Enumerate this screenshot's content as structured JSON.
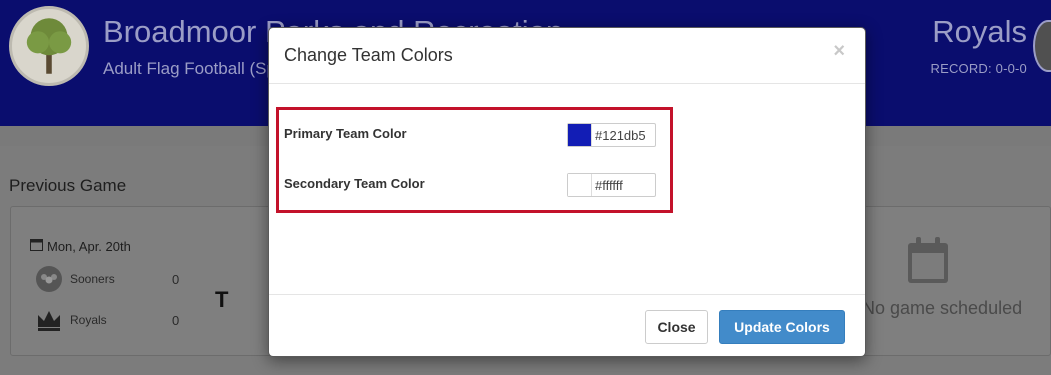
{
  "header": {
    "org_name": "Broadmoor Parks and Recreation",
    "league": "Adult Flag Football (Spring)",
    "team_name": "Royals",
    "record": "RECORD: 0-0-0"
  },
  "previous_game": {
    "section_title": "Previous Game",
    "date": "Mon, Apr. 20th",
    "home_team": "Sooners",
    "home_score": "0",
    "away_team": "Royals",
    "away_score": "0",
    "result": "T"
  },
  "next_game": {
    "status": "No game scheduled"
  },
  "modal": {
    "title": "Change Team Colors",
    "close_symbol": "×",
    "primary_label": "Primary Team Color",
    "primary_value": "#121db5",
    "secondary_label": "Secondary Team Color",
    "secondary_value": "#ffffff",
    "close_button": "Close",
    "update_button": "Update Colors"
  },
  "colors": {
    "primary": "#121db5",
    "secondary": "#ffffff",
    "highlight": "#c3122a",
    "accent": "#428bca"
  }
}
